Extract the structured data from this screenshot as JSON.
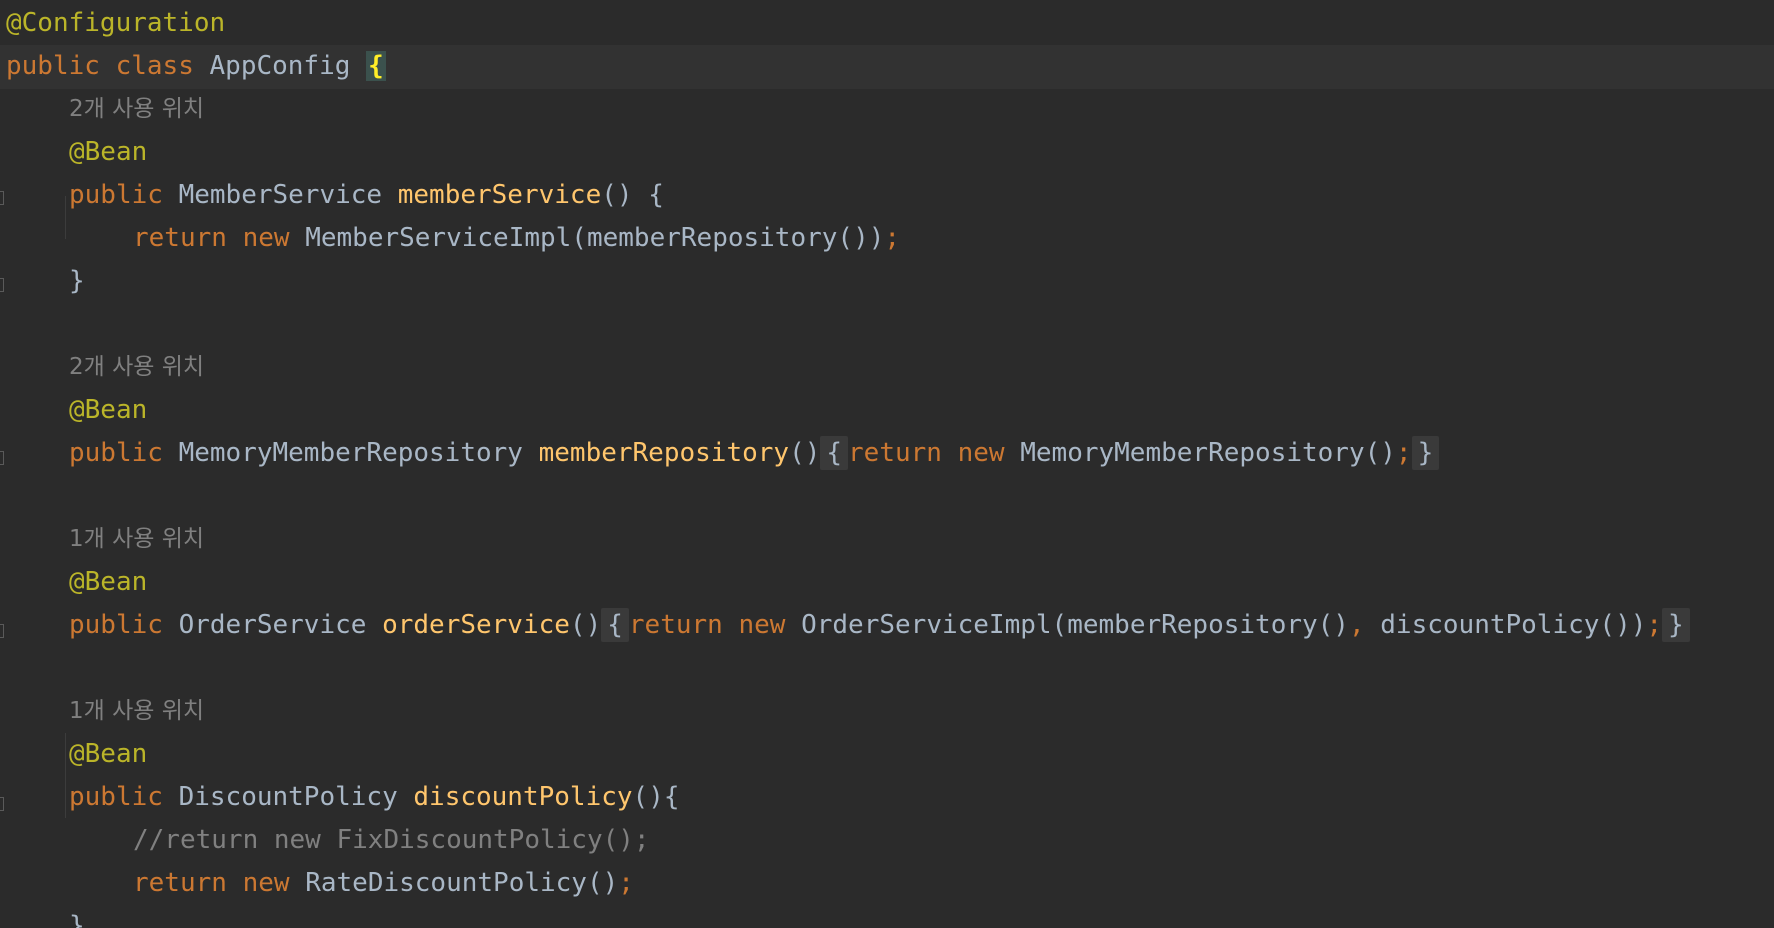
{
  "editor": {
    "lines": [
      {
        "kind": "annotation",
        "text": "@Configuration"
      },
      {
        "kind": "class_decl",
        "public": "public",
        "class_kw": "class",
        "name": "AppConfig",
        "brace": "{"
      },
      {
        "kind": "hint",
        "text": "2개 사용 위치"
      },
      {
        "kind": "annotation",
        "text": "@Bean"
      },
      {
        "kind": "method",
        "public": "public",
        "type": "MemberService",
        "name": "memberService",
        "rest": "() {"
      },
      {
        "kind": "return",
        "return_kw": "return",
        "new_kw": "new",
        "expr": "MemberServiceImpl(memberRepository())",
        "semi": ";"
      },
      {
        "kind": "close",
        "text": "}"
      },
      {
        "kind": "hint",
        "text": "2개 사용 위치"
      },
      {
        "kind": "annotation",
        "text": "@Bean"
      },
      {
        "kind": "folded_method",
        "public": "public",
        "type": "MemoryMemberRepository",
        "name": "memberRepository",
        "parens": "()",
        "open": "{",
        "return_kw": "return",
        "new_kw": "new",
        "expr": "MemoryMemberRepository()",
        "semi": ";",
        "close": "}"
      },
      {
        "kind": "hint",
        "text": "1개 사용 위치"
      },
      {
        "kind": "annotation",
        "text": "@Bean"
      },
      {
        "kind": "folded_method2",
        "public": "public",
        "type": "OrderService",
        "name": "orderService",
        "parens": "()",
        "open": "{",
        "return_kw": "return",
        "new_kw": "new",
        "expr_a": "OrderServiceImpl(memberRepository()",
        "comma": ",",
        "expr_b": " discountPolicy())",
        "semi": ";",
        "close": "}"
      },
      {
        "kind": "hint",
        "text": "1개 사용 위치"
      },
      {
        "kind": "annotation",
        "text": "@Bean"
      },
      {
        "kind": "method",
        "public": "public",
        "type": "DiscountPolicy",
        "name": "discountPolicy",
        "rest": "(){"
      },
      {
        "kind": "comment",
        "text": "//return new FixDiscountPolicy();"
      },
      {
        "kind": "return",
        "return_kw": "return",
        "new_kw": "new",
        "expr": "RateDiscountPolicy()",
        "semi": ";"
      },
      {
        "kind": "close",
        "text": "}"
      }
    ]
  }
}
